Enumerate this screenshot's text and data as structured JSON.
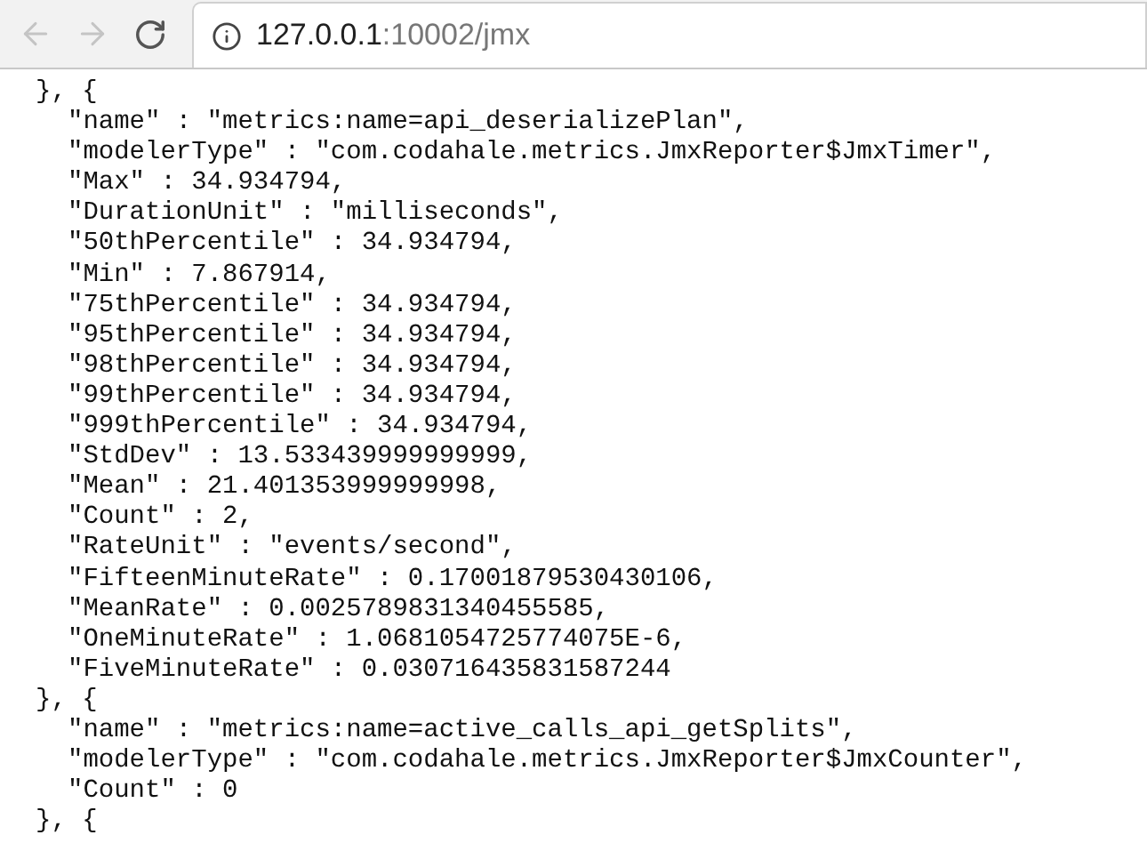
{
  "toolbar": {
    "back": {
      "disabled": true
    },
    "forward": {
      "disabled": true
    },
    "address": {
      "host": "127.0.0.1",
      "path": ":10002/jmx"
    }
  },
  "lines": [
    {
      "kind": "brace",
      "text": "}, {"
    },
    {
      "kind": "entry",
      "text": "\"name\" : \"metrics:name=api_deserializePlan\","
    },
    {
      "kind": "entry",
      "text": "\"modelerType\" : \"com.codahale.metrics.JmxReporter$JmxTimer\","
    },
    {
      "kind": "entry",
      "text": "\"Max\" : 34.934794,"
    },
    {
      "kind": "entry",
      "text": "\"DurationUnit\" : \"milliseconds\","
    },
    {
      "kind": "entry",
      "text": "\"50thPercentile\" : 34.934794,"
    },
    {
      "kind": "entry",
      "text": "\"Min\" : 7.867914,"
    },
    {
      "kind": "entry",
      "text": "\"75thPercentile\" : 34.934794,"
    },
    {
      "kind": "entry",
      "text": "\"95thPercentile\" : 34.934794,"
    },
    {
      "kind": "entry",
      "text": "\"98thPercentile\" : 34.934794,"
    },
    {
      "kind": "entry",
      "text": "\"99thPercentile\" : 34.934794,"
    },
    {
      "kind": "entry",
      "text": "\"999thPercentile\" : 34.934794,"
    },
    {
      "kind": "entry",
      "text": "\"StdDev\" : 13.533439999999999,"
    },
    {
      "kind": "entry",
      "text": "\"Mean\" : 21.401353999999998,"
    },
    {
      "kind": "entry",
      "text": "\"Count\" : 2,"
    },
    {
      "kind": "entry",
      "text": "\"RateUnit\" : \"events/second\","
    },
    {
      "kind": "entry",
      "text": "\"FifteenMinuteRate\" : 0.17001879530430106,"
    },
    {
      "kind": "entry",
      "text": "\"MeanRate\" : 0.0025789831340455585,"
    },
    {
      "kind": "entry",
      "text": "\"OneMinuteRate\" : 1.0681054725774075E-6,"
    },
    {
      "kind": "entry",
      "text": "\"FiveMinuteRate\" : 0.030716435831587244"
    },
    {
      "kind": "brace",
      "text": "}, {"
    },
    {
      "kind": "entry",
      "text": "\"name\" : \"metrics:name=active_calls_api_getSplits\","
    },
    {
      "kind": "entry",
      "text": "\"modelerType\" : \"com.codahale.metrics.JmxReporter$JmxCounter\","
    },
    {
      "kind": "entry",
      "text": "\"Count\" : 0"
    },
    {
      "kind": "brace",
      "text": "}, {"
    }
  ]
}
